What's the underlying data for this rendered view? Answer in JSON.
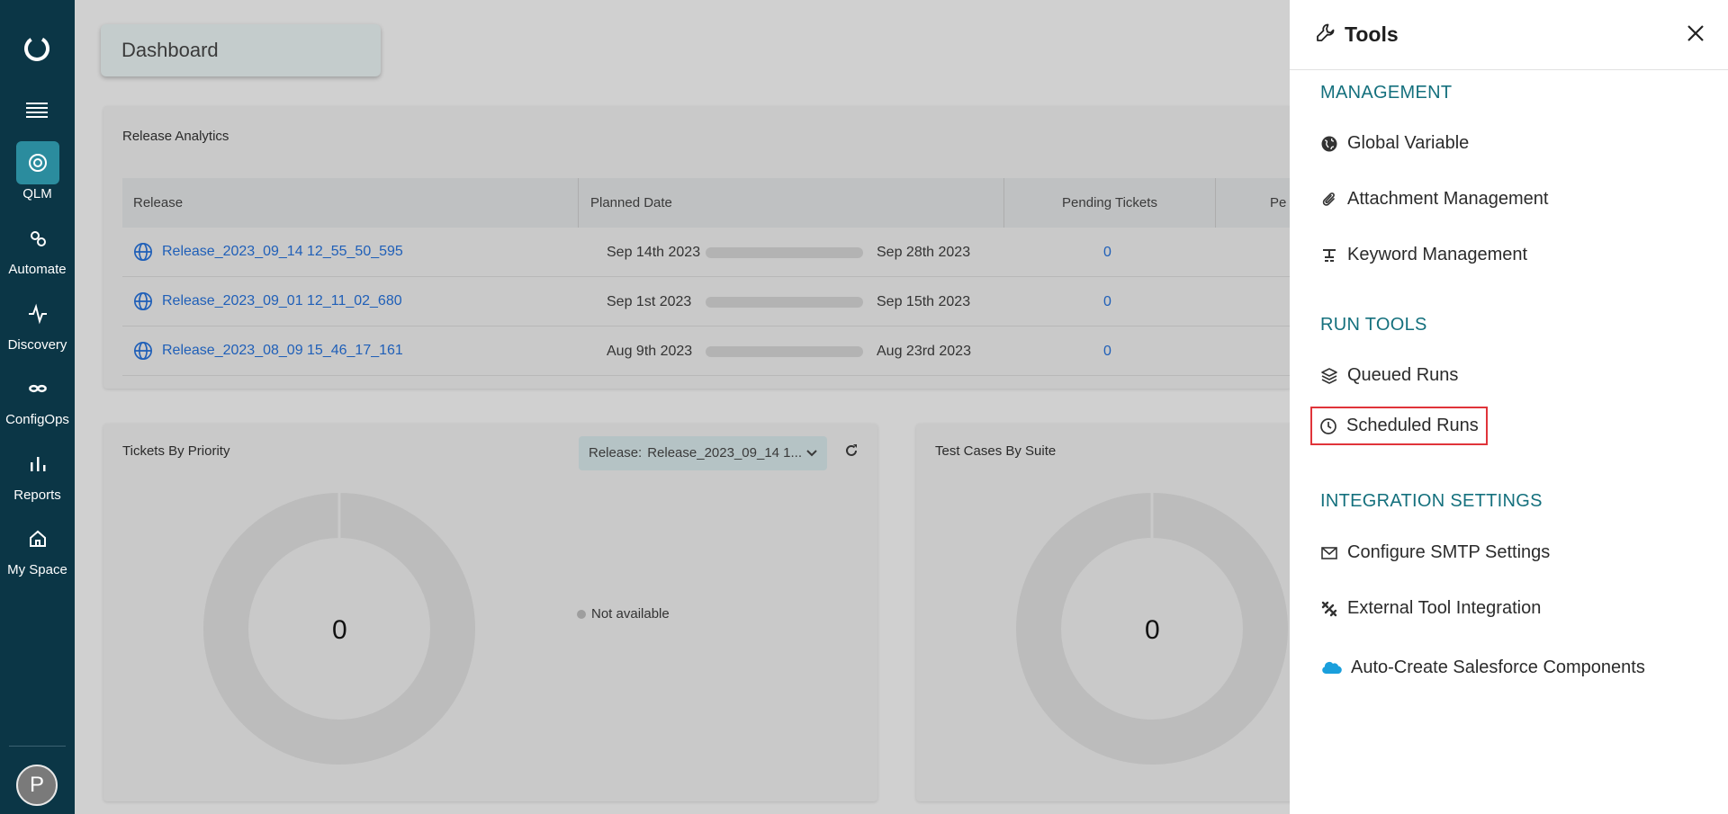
{
  "sidebar": {
    "items": [
      {
        "label": "QLM",
        "icon": "qlm-icon",
        "active": true
      },
      {
        "label": "Automate",
        "icon": "automate-icon"
      },
      {
        "label": "Discovery",
        "icon": "discovery-icon"
      },
      {
        "label": "ConfigOps",
        "icon": "configops-icon"
      },
      {
        "label": "Reports",
        "icon": "reports-icon"
      },
      {
        "label": "My Space",
        "icon": "home-icon"
      }
    ],
    "avatar": "P"
  },
  "page": {
    "title": "Dashboard"
  },
  "release_analytics": {
    "title": "Release Analytics",
    "columns": [
      "Release",
      "Planned Date",
      "Pending Tickets",
      "Pe"
    ],
    "rows": [
      {
        "release": "Release_2023_09_14 12_55_50_595",
        "start": "Sep 14th 2023",
        "end": "Sep 28th 2023",
        "pending": "0"
      },
      {
        "release": "Release_2023_09_01 12_11_02_680",
        "start": "Sep 1st 2023",
        "end": "Sep 15th 2023",
        "pending": "0"
      },
      {
        "release": "Release_2023_08_09 15_46_17_161",
        "start": "Aug 9th 2023",
        "end": "Aug 23rd 2023",
        "pending": "0"
      }
    ]
  },
  "tickets_by_priority": {
    "title": "Tickets By Priority",
    "release_label": "Release:",
    "release_value": "Release_2023_09_14 1...",
    "center_value": "0",
    "legend": "Not available"
  },
  "test_cases_by_suite": {
    "title": "Test Cases By Suite",
    "center_value": "0"
  },
  "tools_panel": {
    "title": "Tools",
    "sections": {
      "management": "MANAGEMENT",
      "run_tools": "RUN TOOLS",
      "integration": "INTEGRATION SETTINGS"
    },
    "items": {
      "global_variable": "Global Variable",
      "attachment_management": "Attachment Management",
      "keyword_management": "Keyword Management",
      "queued_runs": "Queued Runs",
      "scheduled_runs": "Scheduled Runs",
      "smtp": "Configure SMTP Settings",
      "external_tool": "External Tool Integration",
      "salesforce": "Auto-Create Salesforce Components"
    }
  },
  "colors": {
    "sidebar_bg": "#0b3646",
    "accent": "#14707d",
    "link": "#1f5fb8",
    "highlight": "#e0343a"
  }
}
